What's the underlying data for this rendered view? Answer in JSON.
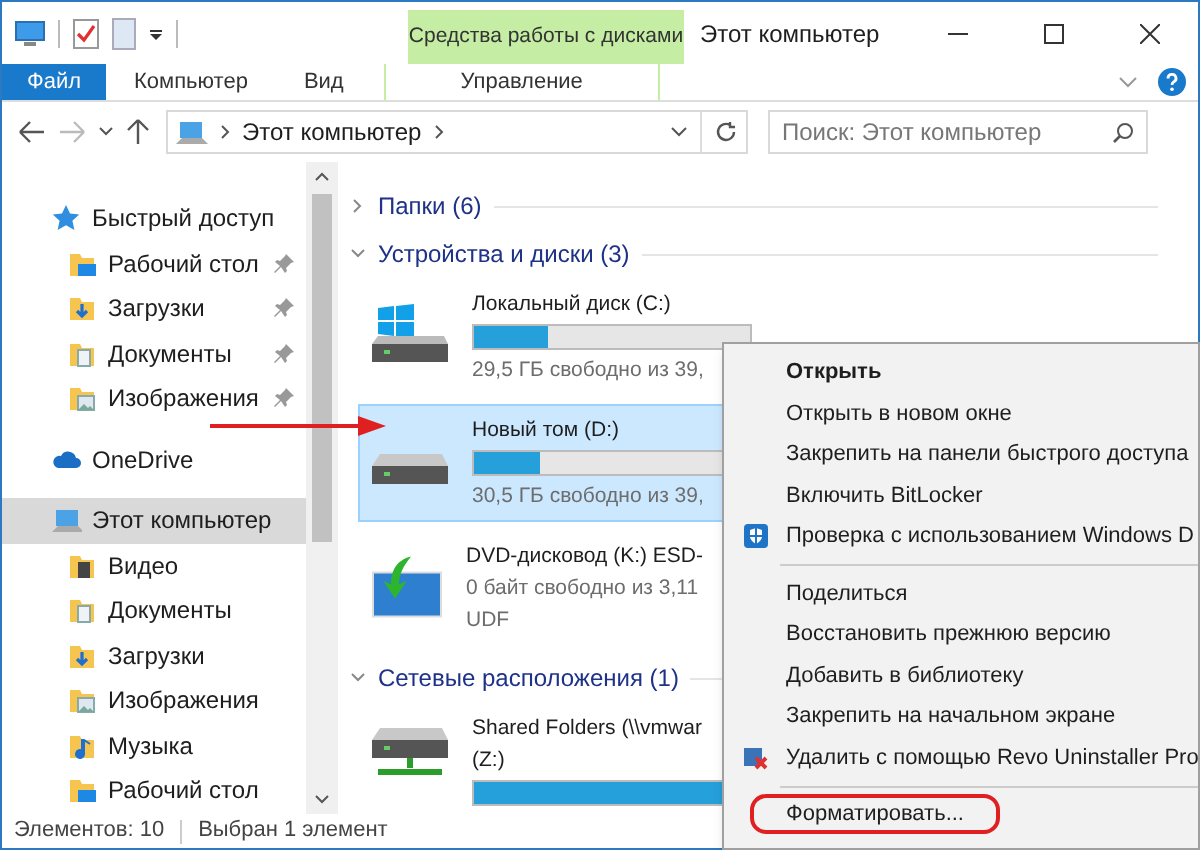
{
  "title_bar": {
    "contextual_group": "Средства работы с дисками",
    "title": "Этот компьютер"
  },
  "ribbon_tabs": [
    {
      "label": "Файл",
      "kind": "file",
      "selected": false
    },
    {
      "label": "Компьютер",
      "kind": "tab",
      "selected": false
    },
    {
      "label": "Вид",
      "kind": "tab",
      "selected": false
    },
    {
      "label": "Управление",
      "kind": "contextual",
      "selected": false
    }
  ],
  "address_bar": {
    "segments": [
      "Этот компьютер"
    ]
  },
  "search": {
    "placeholder": "Поиск: Этот компьютер"
  },
  "nav_pane": {
    "items": [
      {
        "label": "Быстрый доступ",
        "kind": "star",
        "selected": false,
        "children": [
          {
            "label": "Рабочий стол",
            "kind": "desktop",
            "pinned": true,
            "selected": false
          },
          {
            "label": "Загрузки",
            "kind": "downloads",
            "pinned": true,
            "selected": false
          },
          {
            "label": "Документы",
            "kind": "documents",
            "pinned": true,
            "selected": false
          },
          {
            "label": "Изображения",
            "kind": "pictures",
            "pinned": true,
            "selected": false
          }
        ]
      },
      {
        "label": "OneDrive",
        "kind": "cloud",
        "selected": false
      },
      {
        "label": "Этот компьютер",
        "kind": "computer",
        "selected": true,
        "children": [
          {
            "label": "Видео",
            "kind": "video",
            "pinned": false,
            "selected": false
          },
          {
            "label": "Документы",
            "kind": "documents",
            "pinned": false,
            "selected": false
          },
          {
            "label": "Загрузки",
            "kind": "downloads",
            "pinned": false,
            "selected": false
          },
          {
            "label": "Изображения",
            "kind": "pictures",
            "pinned": false,
            "selected": false
          },
          {
            "label": "Музыка",
            "kind": "music",
            "pinned": false,
            "selected": false
          },
          {
            "label": "Рабочий стол",
            "kind": "desktop",
            "pinned": false,
            "selected": false
          }
        ]
      }
    ]
  },
  "groups": [
    {
      "title": "Папки (6)",
      "expanded": false
    },
    {
      "title": "Устройства и диски (3)",
      "expanded": true,
      "items": [
        {
          "kind": "windows-drive",
          "lines": [
            "Локальный диск (C:)"
          ],
          "level": 0.27,
          "details": [
            "29,5 ГБ свободно из 39,"
          ],
          "selected": false
        },
        {
          "kind": "drive",
          "lines": [
            "Новый том (D:)"
          ],
          "level": 0.24,
          "details": [
            "30,5 ГБ свободно из 39,"
          ],
          "selected": true
        },
        {
          "kind": "dvd",
          "lines": [
            "DVD-дисковод (K:) ESD-"
          ],
          "details": [
            "0 байт свободно из 3,11",
            "UDF"
          ],
          "selected": false
        }
      ]
    },
    {
      "title": "Сетевые расположения (1)",
      "expanded": true,
      "items": [
        {
          "kind": "network-drive",
          "lines": [
            "Shared Folders (\\\\vmwar",
            "(Z:)"
          ],
          "level": 1,
          "selected": false
        }
      ]
    }
  ],
  "context_menu": {
    "items": [
      {
        "kind": "item",
        "label": "Открыть",
        "bold": true,
        "highlighted": false
      },
      {
        "kind": "item",
        "label": "Открыть в новом окне",
        "bold": false,
        "highlighted": false
      },
      {
        "kind": "item",
        "label": "Закрепить на панели быстрого доступа",
        "bold": false,
        "highlighted": false
      },
      {
        "kind": "item",
        "label": "Включить BitLocker",
        "bold": false,
        "highlighted": false
      },
      {
        "kind": "shield-item",
        "label": "Проверка с использованием Windows D",
        "bold": false,
        "highlighted": false
      },
      {
        "kind": "separator"
      },
      {
        "kind": "item",
        "label": "Поделиться",
        "bold": false,
        "highlighted": false
      },
      {
        "kind": "item",
        "label": "Восстановить прежнюю версию",
        "bold": false,
        "highlighted": false
      },
      {
        "kind": "item",
        "label": "Добавить в библиотеку",
        "bold": false,
        "highlighted": false
      },
      {
        "kind": "item",
        "label": "Закрепить на начальном экране",
        "bold": false,
        "highlighted": false
      },
      {
        "kind": "uninstaller-item",
        "label": "Удалить с помощью Revo Uninstaller Pro",
        "bold": false,
        "highlighted": false
      },
      {
        "kind": "separator"
      },
      {
        "kind": "item",
        "label": "Форматировать...",
        "bold": false,
        "highlighted": true
      }
    ]
  },
  "status_bar": {
    "item_count": "Элементов: 10",
    "selection": "Выбран 1 элемент"
  }
}
